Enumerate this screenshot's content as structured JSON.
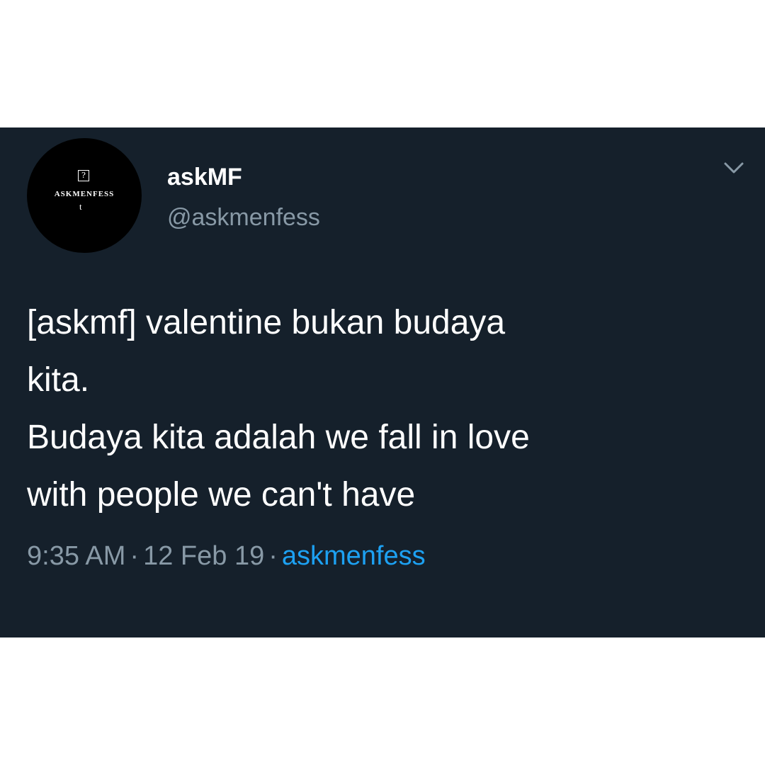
{
  "tweet": {
    "avatar": {
      "badge_text": "?",
      "wordmark": "ASKMENFESS",
      "monogram": "t"
    },
    "display_name": "askMF",
    "handle": "@askmenfess",
    "text": "[askmf] valentine bukan budaya\nkita.\nBudaya kita adalah we fall in love\nwith people we can't have",
    "time": "9:35 AM",
    "date": "12 Feb 19",
    "separator": "·",
    "source": "askmenfess"
  },
  "icons": {
    "menu": "chevron-down-icon"
  },
  "colors": {
    "card_background": "#15202b",
    "page_background": "#ffffff",
    "primary_text": "#ffffff",
    "secondary_text": "#8899a6",
    "link": "#1da1f2"
  }
}
